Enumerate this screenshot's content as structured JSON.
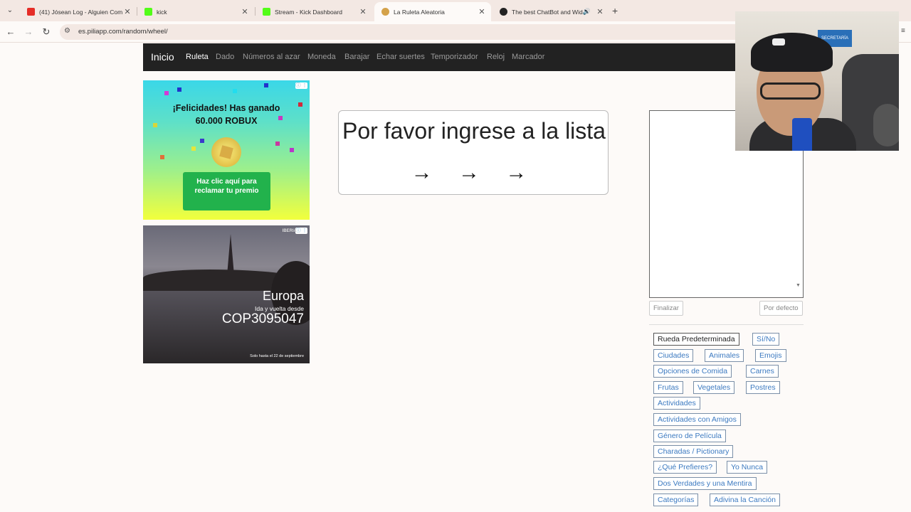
{
  "browser": {
    "tabs": [
      {
        "title": "(41) Jósean Log - Alguien Com",
        "favicon_color": "#e52d27",
        "icon": "youtube-icon"
      },
      {
        "title": "kick",
        "favicon_color": "#53fc18",
        "icon": "kick-icon"
      },
      {
        "title": "Stream - Kick Dashboard",
        "favicon_color": "#53fc18",
        "icon": "kick-icon"
      },
      {
        "title": "La Ruleta Aleatoria",
        "favicon_color": "#d4a24a",
        "icon": "piliapp-icon"
      },
      {
        "title": "The best ChatBot and Widg",
        "favicon_color": "#222222",
        "icon": "github-icon"
      }
    ],
    "url": "es.piliapp.com/random/wheel/"
  },
  "site": {
    "brand": "Inicio",
    "nav": [
      "Ruleta",
      "Dado",
      "Números al azar",
      "Moneda",
      "Barajar",
      "Echar suertes",
      "Temporizador",
      "Reloj",
      "Marcador"
    ]
  },
  "ad1": {
    "line1": "¡Felicidades! Has ganado",
    "line2": "60.000 ROBUX",
    "button": "Haz clic aquí para reclamar tu premio"
  },
  "ad2": {
    "brand": "IBERIA",
    "title": "Europa",
    "subtitle": "Ida y vuelta desde",
    "price": "COP3095047",
    "footer": "Solo hasta el 22 de septiembre"
  },
  "wheel": {
    "message": "Por favor ingrese a la lista",
    "arrows": "→ → →"
  },
  "panel": {
    "list_value": "",
    "finish_button": "Finalizar",
    "default_button": "Por defecto",
    "presets": [
      "Rueda Predeterminada",
      "Sí/No",
      "Ciudades",
      "Animales",
      "Emojis",
      "Opciones de Comida",
      "Carnes",
      "Frutas",
      "Vegetales",
      "Postres",
      "Actividades",
      "Actividades con Amigos",
      "Género de Película",
      "Charadas / Pictionary",
      "¿Qué Prefieres?",
      "Yo Nunca",
      "Dos Verdades y una Mentira",
      "Categorías",
      "Adivina la Canción"
    ]
  },
  "webcam": {
    "sign": "SECRETARÍA"
  }
}
